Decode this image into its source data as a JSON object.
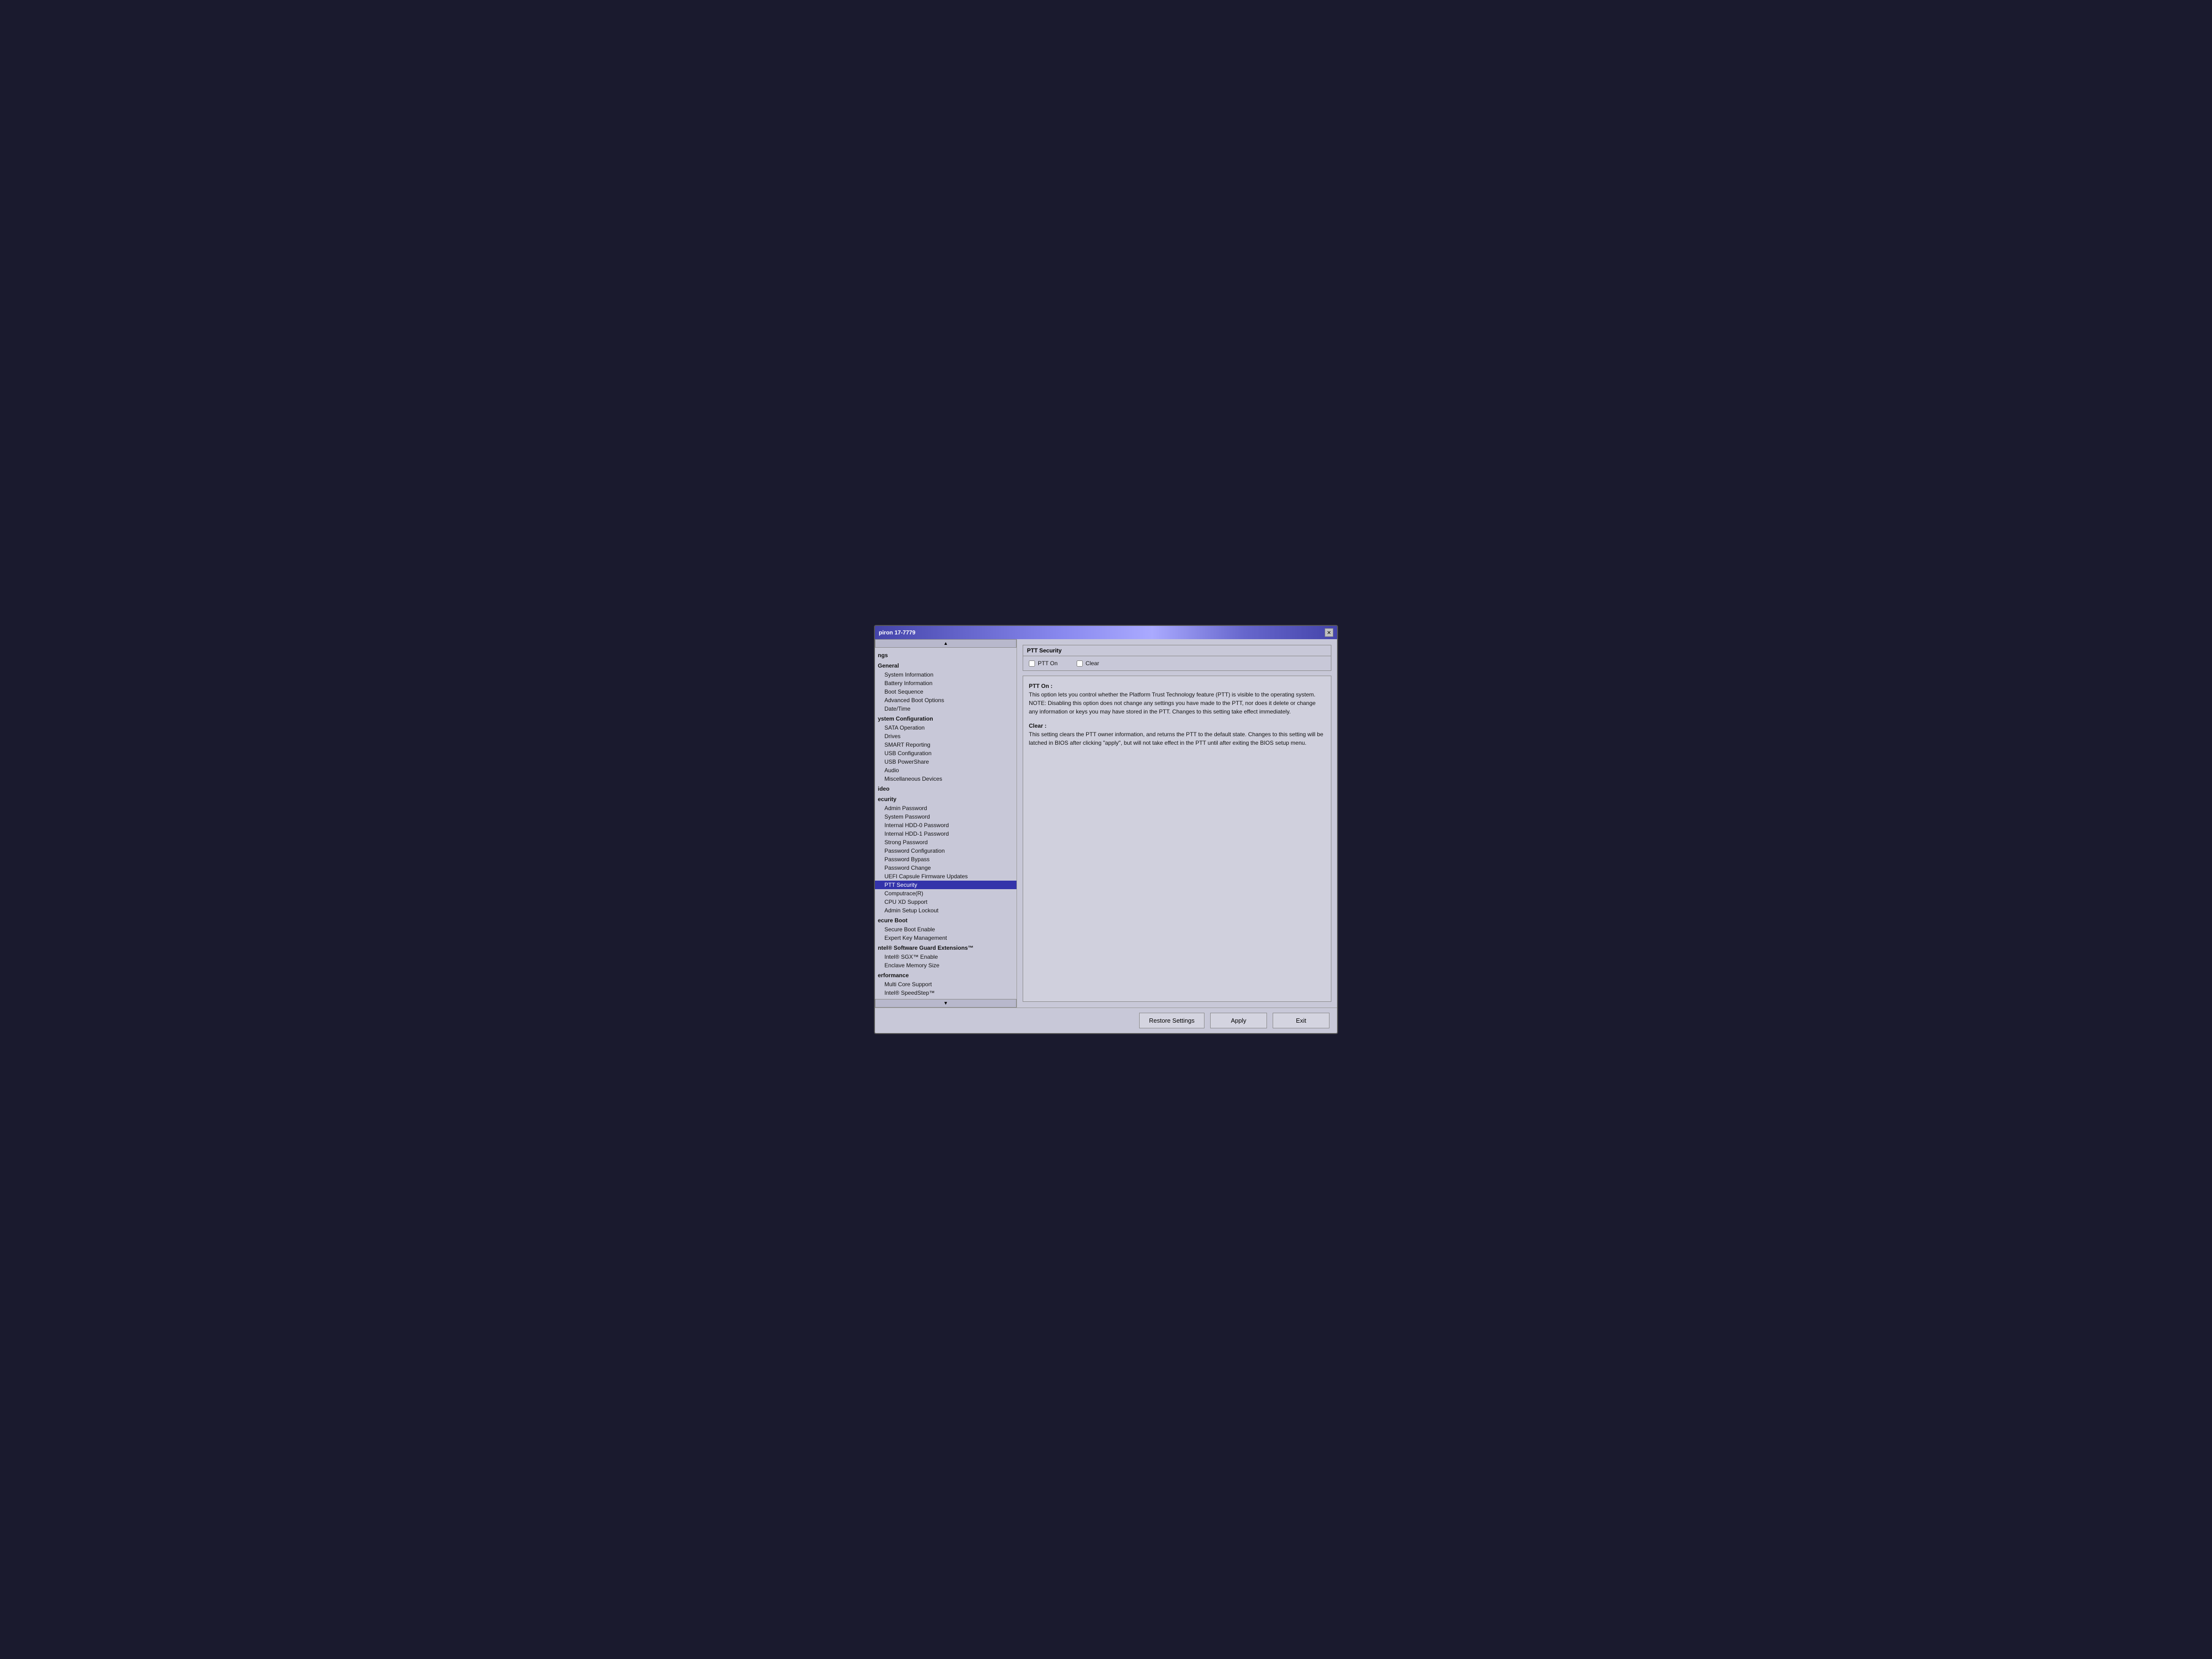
{
  "window": {
    "title": "piron 17-7779",
    "close_label": "✕"
  },
  "sidebar": {
    "scroll_up": "▲",
    "scroll_down": "▼",
    "sections": [
      {
        "label": "ngs",
        "items": []
      },
      {
        "label": "General",
        "items": [
          "System Information",
          "Battery Information",
          "Boot Sequence",
          "Advanced Boot Options",
          "Date/Time"
        ]
      },
      {
        "label": "ystem Configuration",
        "items": [
          "SATA Operation",
          "Drives",
          "SMART Reporting",
          "USB Configuration",
          "USB PowerShare",
          "Audio",
          "Miscellaneous Devices"
        ]
      },
      {
        "label": "ideo",
        "items": []
      },
      {
        "label": "ecurity",
        "items": [
          "Admin Password",
          "System Password",
          "Internal HDD-0 Password",
          "Internal HDD-1 Password",
          "Strong Password",
          "Password Configuration",
          "Password Bypass",
          "Password Change",
          "UEFI Capsule Firmware Updates",
          "PTT Security",
          "Computrace(R)",
          "CPU XD Support",
          "Admin Setup Lockout"
        ]
      },
      {
        "label": "ecure Boot",
        "items": [
          "Secure Boot Enable",
          "Expert Key Management"
        ]
      },
      {
        "label": "ntel® Software Guard Extensions™",
        "items": [
          "Intel® SGX™ Enable",
          "Enclave Memory Size"
        ]
      },
      {
        "label": "erformance",
        "items": [
          "Multi Core Support",
          "Intel® SpeedStep™"
        ]
      }
    ]
  },
  "main_panel": {
    "ptt_group_label": "PTT Security",
    "ptt_on_label": "PTT On",
    "clear_label": "Clear",
    "ptt_on_checked": false,
    "clear_checked": false,
    "description_sections": [
      {
        "title": "PTT On :",
        "text": "This option lets you control whether the Platform Trust Technology feature (PTT) is visible to the operating system.\nNOTE: Disabling this option does not change any settings you have made to the PTT, nor does it delete or change any information or keys you may have stored in the PTT. Changes to this setting take effect immediately."
      },
      {
        "title": "Clear :",
        "text": "This setting clears the PTT owner information, and returns the PTT to the default state. Changes to this setting will be latched in BIOS after clicking \"apply\", but will not take effect in the PTT until after exiting the BIOS setup menu."
      }
    ]
  },
  "buttons": {
    "restore": "Restore Settings",
    "apply": "Apply",
    "exit": "Exit"
  }
}
